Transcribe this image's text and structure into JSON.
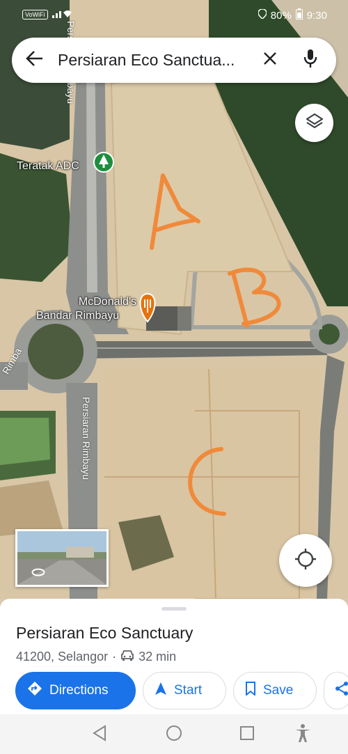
{
  "status": {
    "battery": "80%",
    "time": "9:30",
    "wifi_tag": "VoWiFi"
  },
  "search": {
    "query": "Persiaran Eco Sanctua..."
  },
  "map": {
    "pois": [
      {
        "name": "Teratak ADC"
      },
      {
        "name_line1": "McDonald's",
        "name_line2": "Bandar Rimbayu"
      }
    ],
    "road_labels": [
      "Persiaran Rimbayu",
      "Persiaran Rimbayu",
      "Rimba"
    ],
    "annotations": [
      "A",
      "B",
      "C"
    ]
  },
  "place": {
    "title": "Persiaran Eco Sanctuary",
    "postcode_region": "41200, Selangor",
    "separator": "·",
    "drive_time": "32 min"
  },
  "actions": {
    "directions": "Directions",
    "start": "Start",
    "save": "Save"
  },
  "colors": {
    "accent": "#1a73e8",
    "annotation": "#f08a3a"
  }
}
